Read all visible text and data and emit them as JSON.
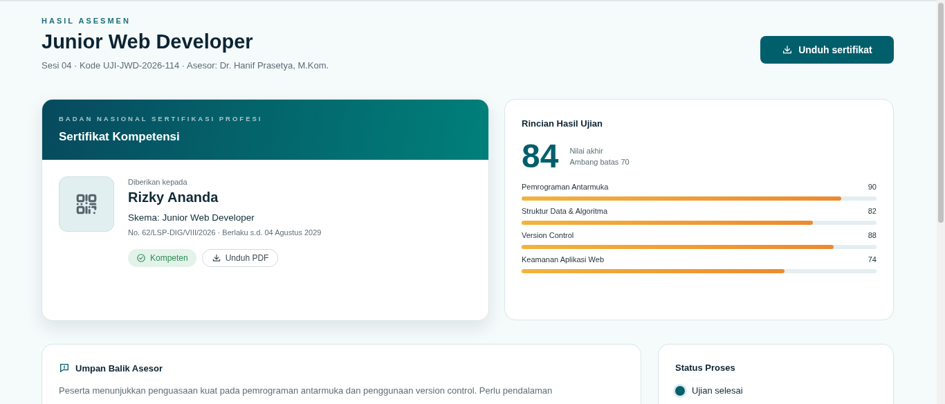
{
  "header": {
    "eyebrow": "HASIL ASESMEN",
    "title": "Junior Web Developer",
    "subtitle": "Sesi 04 · Kode UJI-JWD-2026-114 · Asesor: Dr. Hanif Prasetya, M.Kom.",
    "download_button": "Unduh sertifikat"
  },
  "certificate": {
    "issuer": "BADAN NASIONAL SERTIFIKASI PROFESI",
    "title": "Sertifikat Kompetensi",
    "given_to_label": "Diberikan kepada",
    "recipient": "Rizky Ananda",
    "scheme": "Skema: Junior Web Developer",
    "meta": "No. 62/LSP-DIG/VIII/2026 · Berlaku s.d. 04 Agustus 2029",
    "status_badge": "Kompeten",
    "pdf_button": "Unduh PDF"
  },
  "results": {
    "title": "Rincian Hasil Ujian",
    "score": "84",
    "score_label": "Nilai akhir",
    "threshold": "Ambang batas 70",
    "subjects": [
      {
        "name": "Pemrograman Antarmuka",
        "value": "90",
        "level": 0.9
      },
      {
        "name": "Struktur Data & Algoritma",
        "value": "82",
        "level": 0.82
      },
      {
        "name": "Version Control",
        "value": "88",
        "level": 0.88
      },
      {
        "name": "Keamanan Aplikasi Web",
        "value": "74",
        "level": 0.74
      }
    ]
  },
  "feedback": {
    "title": "Umpan Balik Asesor",
    "text": "Peserta menunjukkan penguasaan kuat pada pemrograman antarmuka dan penggunaan version control. Perlu pendalaman"
  },
  "status": {
    "title": "Status Proses",
    "steps": [
      {
        "label": "Ujian selesai",
        "completed": true
      }
    ]
  }
}
